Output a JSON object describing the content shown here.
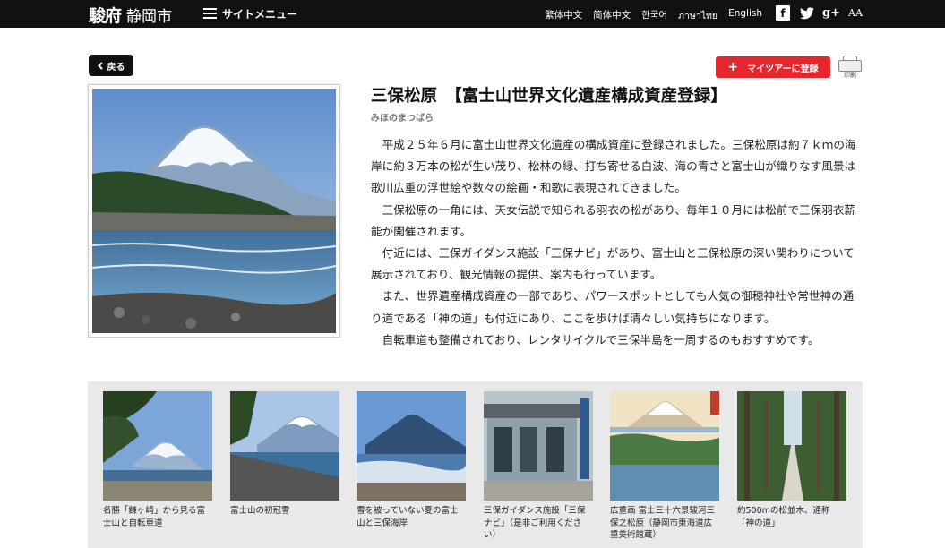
{
  "header": {
    "logo_mark": "駿府",
    "logo_city": "静岡市",
    "menu_label": "サイトメニュー",
    "languages": [
      "繁体中文",
      "简体中文",
      "한국어",
      "ภาษาไทย",
      "English"
    ],
    "social": {
      "facebook": "f",
      "google": "g+",
      "font_size": "AA"
    }
  },
  "back_label": "戻る",
  "actions": {
    "mytour_label": "マイツアーに登録",
    "print_label": "印刷"
  },
  "spot": {
    "title": "三保松原　【富士山世界文化遺産構成資産登録】",
    "reading": "みほのまつばら",
    "paragraphs": [
      "平成２５年６月に富士山世界文化遺産の構成資産に登録されました。三保松原は約７ｋｍの海岸に約３万本の松が生い茂り、松林の緑、打ち寄せる白波、海の青さと富士山が織りなす風景は歌川広重の浮世絵や数々の絵画・和歌に表現されてきました。",
      "三保松原の一角には、天女伝説で知られる羽衣の松があり、毎年１０月には松前で三保羽衣薪能が開催されます。",
      "付近には、三保ガイダンス施設「三保ナビ」があり、富士山と三保松原の深い関わりについて展示されており、観光情報の提供、案内も行っています。",
      "また、世界遺産構成資産の一部であり、パワースポットとしても人気の御穂神社や常世神の通り道である「神の道」も付近にあり、ここを歩けば清々しい気持ちになります。",
      "自転車道も整備されており、レンタサイクルで三保半島を一周するのもおすすめです。"
    ]
  },
  "gallery": [
    {
      "caption": "名勝「鎌ヶ崎」から見る富士山と自転車道"
    },
    {
      "caption": "富士山の初冠雪"
    },
    {
      "caption": "雪を被っていない夏の富士山と三保海岸"
    },
    {
      "caption": "三保ガイダンス施設「三保ナビ」（是非ご利用ください）"
    },
    {
      "caption": "広重画 富士三十六景駿河三保之松原（静岡市東海道広重美術館蔵）"
    },
    {
      "caption": "約500mの松並木、通称「神の道」"
    }
  ],
  "colors": {
    "topbar": "#111111",
    "accent_red": "#e5262d",
    "gallery_bg": "#e9e9e9"
  }
}
